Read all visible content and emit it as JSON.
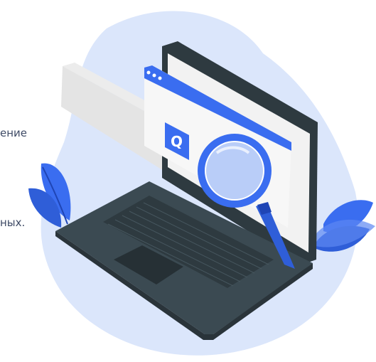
{
  "text_fragments": {
    "line1": "ение",
    "line2": "ных."
  },
  "illustration": {
    "search_glyph": "Q",
    "icon_names": [
      "magnifier-icon",
      "search-icon",
      "laptop-icon",
      "leaf-icon"
    ]
  },
  "colors": {
    "blob": "#d9e5fb",
    "accent_blue": "#3a6df0",
    "light_blue": "#8fb2f7",
    "laptop_dark": "#3b4a52",
    "laptop_mid": "#2e3a40",
    "screen_white": "#f2f2f2",
    "panel_gray": "#e3e3e3"
  }
}
